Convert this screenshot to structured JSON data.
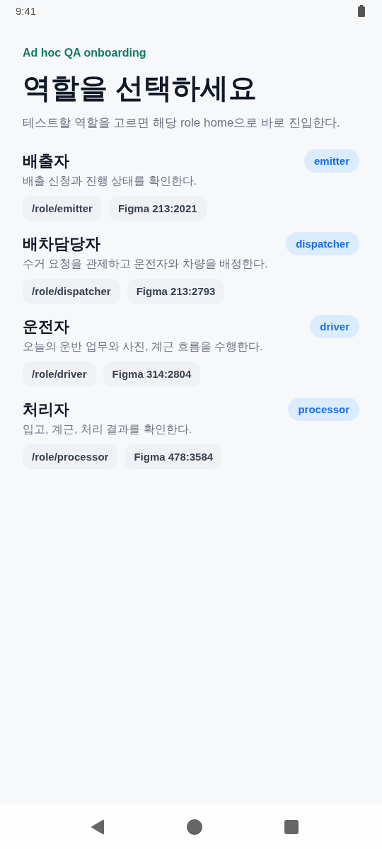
{
  "status_bar": {
    "time": "9:41"
  },
  "eyebrow": "Ad hoc QA onboarding",
  "title": "역할을 선택하세요",
  "subtitle": "테스트할 역할을 고르면 해당 role home으로 바로 진입한다.",
  "roles": [
    {
      "name": "배출자",
      "badge": "emitter",
      "description": "배출 신청과 진행 상태를 확인한다.",
      "route": "/role/emitter",
      "figma": "Figma 213:2021"
    },
    {
      "name": "배차담당자",
      "badge": "dispatcher",
      "description": "수거 요청을 관제하고 운전자와 차량을 배정한다.",
      "route": "/role/dispatcher",
      "figma": "Figma 213:2793"
    },
    {
      "name": "운전자",
      "badge": "driver",
      "description": "오늘의 운반 업무와 사진, 계근 흐름을 수행한다.",
      "route": "/role/driver",
      "figma": "Figma 314:2804"
    },
    {
      "name": "처리자",
      "badge": "processor",
      "description": "입고, 계근, 처리 결과를 확인한다.",
      "route": "/role/processor",
      "figma": "Figma 478:3584"
    }
  ]
}
